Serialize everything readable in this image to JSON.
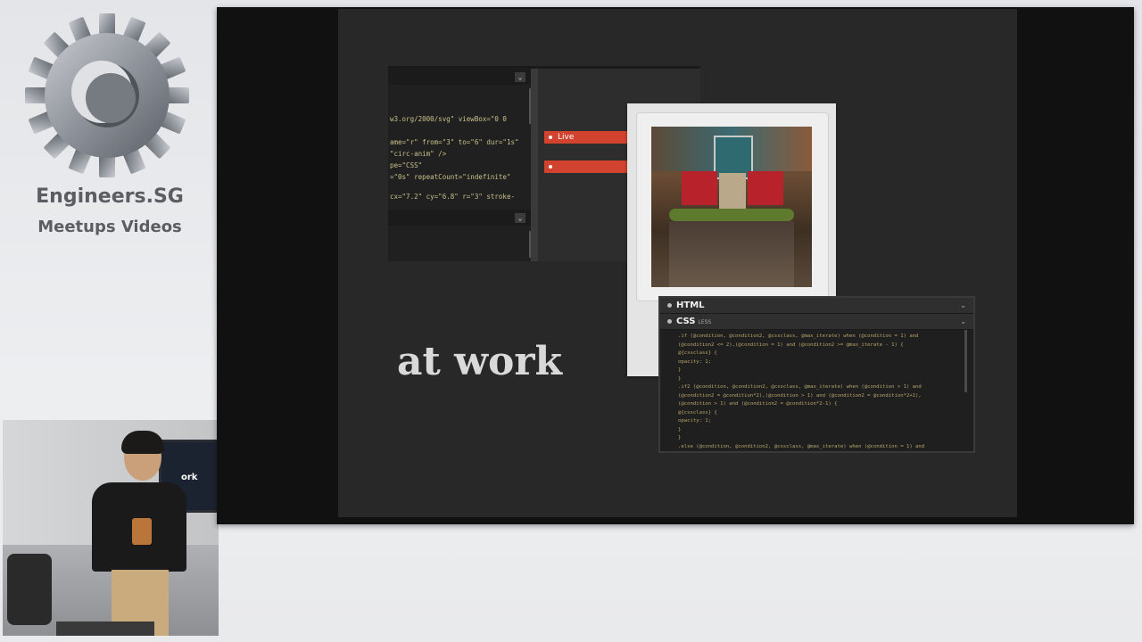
{
  "branding": {
    "logo_icon": "gear-icon",
    "title": "Engineers.SG",
    "subtitle": "Meetups Videos"
  },
  "webcam": {
    "tv_text": "ork"
  },
  "slide": {
    "heading": "at work",
    "editor": {
      "chevron": "⌄",
      "code_lines": [
        "w3.org/2000/svg\" viewBox=\"0 0",
        "ame=\"r\" from=\"3\" to=\"6\" dur=\"1s\"",
        "\"circ-anim\" />",
        "pe=\"CSS\"",
        "=\"0s\" repeatCount=\"indefinite\"",
        "cx=\"7.2\" cy=\"6.8\" r=\"3\" stroke-"
      ],
      "live_label": "Live",
      "second_bar_label": ""
    },
    "css_panel": {
      "html_tab": "HTML",
      "css_tab": "CSS",
      "css_tag": "LESS",
      "chevron": "⌄",
      "code_lines": [
        ".if (@condition, @condition2, @cssclass, @max_iterate) when (@condition = 1) and",
        "(@condition2 <= 2),(@condition = 1) and (@condition2 >= @max_iterate - 1) {",
        "  @{cssclass} {",
        "    opacity: 1;",
        "  }",
        "}",
        ".if2 (@condition, @condition2, @cssclass, @max_iterate) when (@condition > 1) and",
        "(@condition2 = @condition*2),(@condition > 1) and (@condition2 = @condition*2+1),",
        "(@condition > 1) and (@condition2 = @condition*2-1) {",
        "  @{cssclass} {",
        "    opacity: 1;",
        "  }",
        "}",
        ".else (@condition, @condition2, @cssclass, @max_iterate) when (@condition = 1) and"
      ]
    }
  }
}
